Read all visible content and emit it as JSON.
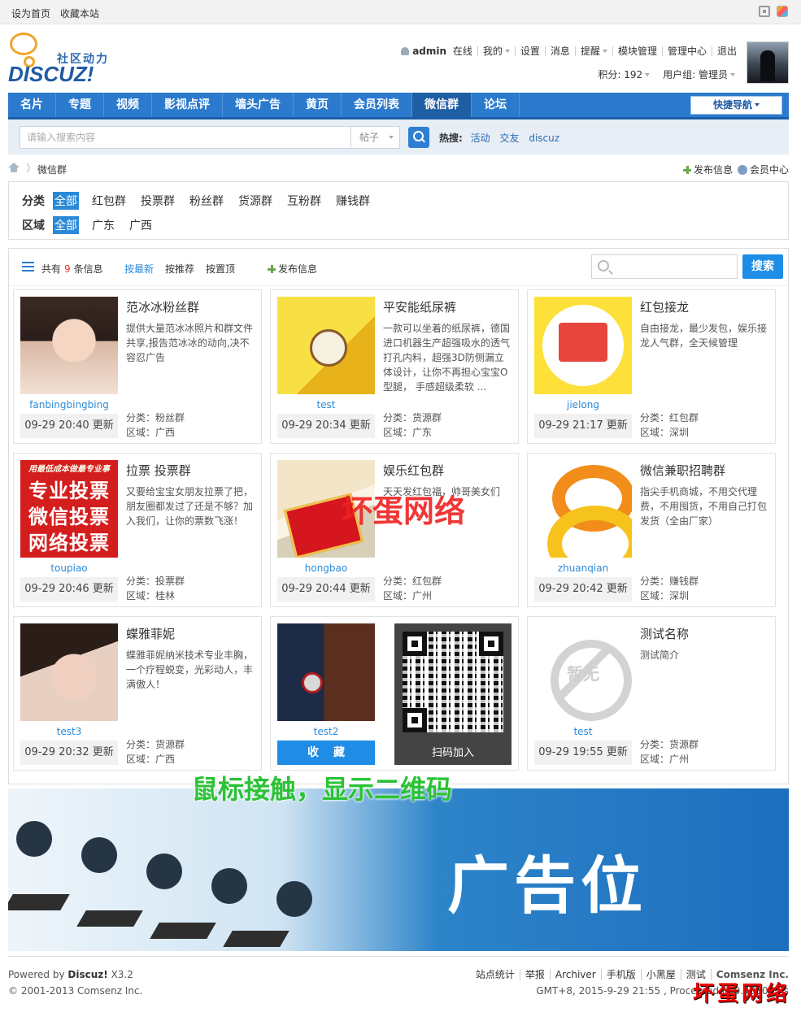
{
  "topbar": {
    "set_home": "设为首页",
    "bookmark": "收藏本站"
  },
  "logo": {
    "cn": "社区动力",
    "en": "DISCUZ!"
  },
  "user": {
    "name": "admin",
    "status": "在线",
    "menu": [
      "我的",
      "设置",
      "消息",
      "提醒",
      "模块管理",
      "管理中心",
      "退出"
    ],
    "points_label": "积分: 192",
    "group_label": "用户组: 管理员"
  },
  "nav": {
    "items": [
      "名片",
      "专题",
      "视频",
      "影视点评",
      "墙头广告",
      "黄页",
      "会员列表",
      "微信群",
      "论坛"
    ],
    "active": "微信群",
    "quick_nav": "快捷导航"
  },
  "search": {
    "placeholder": "请输入搜索内容",
    "type": "帖子",
    "hot_label": "热搜:",
    "hot_words": [
      "活动",
      "交友",
      "discuz"
    ]
  },
  "breadcrumb": {
    "current": "微信群",
    "sep": "〉",
    "publish": "发布信息",
    "member_center": "会员中心"
  },
  "filter": {
    "category_label": "分类",
    "categories": [
      "全部",
      "红包群",
      "投票群",
      "粉丝群",
      "货源群",
      "互粉群",
      "赚钱群"
    ],
    "region_label": "区域",
    "regions": [
      "全部",
      "广东",
      "广西"
    ]
  },
  "toolbar": {
    "total_prefix": "共有",
    "total_count": "9",
    "total_suffix": "条信息",
    "sorts": [
      "按最新",
      "按推荐",
      "按置顶"
    ],
    "publish": "发布信息",
    "search_button": "搜索"
  },
  "cards": [
    {
      "title": "范冰冰粉丝群",
      "desc": "提供大量范冰冰照片和群文件共享,报告范冰冰的动向,决不容忍广告",
      "user": "fanbingbingbing",
      "updated": "09-29 20:40 更新",
      "category": "分类：粉丝群",
      "region": "区域：广西"
    },
    {
      "title": "平安能纸尿裤",
      "desc": "一款可以坐着的纸尿裤，德国进口机器生产超强吸水的透气打孔内料，超强3D防侧漏立体设计，让你不再担心宝宝O型腿， 手感超级柔软 ...",
      "user": "test",
      "updated": "09-29 20:34 更新",
      "category": "分类：货源群",
      "region": "区域：广东"
    },
    {
      "title": "红包接龙",
      "desc": "自由接龙，最少发包，娱乐接龙人气群，全天候管理",
      "user": "jielong",
      "updated": "09-29 21:17 更新",
      "category": "分类：红包群",
      "region": "区域：深圳"
    },
    {
      "title": "拉票 投票群",
      "desc": "又要给宝宝女朋友拉票了把，朋友圈都发过了还是不够？加入我们，让你的票数飞涨！",
      "user": "toupiao",
      "updated": "09-29 20:46 更新",
      "category": "分类：投票群",
      "region": "区域：桂林"
    },
    {
      "title": "娱乐红包群",
      "desc": "天天发红包福，帅哥美女们",
      "user": "hongbao",
      "updated": "09-29 20:44 更新",
      "category": "分类：红包群",
      "region": "区域：广州"
    },
    {
      "title": "微信兼职招聘群",
      "desc": "指尖手机商城，不用交代理费，不用囤货，不用自己打包发货（全由厂家）",
      "user": "zhuanqian",
      "updated": "09-29 20:42 更新",
      "category": "分类：赚钱群",
      "region": "区域：深圳"
    },
    {
      "title": "蝶雅菲妮",
      "desc": "蝶雅菲妮纳米技术专业丰胸，一个疗程蜕变，光彩动人，丰满傲人！",
      "user": "test3",
      "updated": "09-29 20:32 更新",
      "category": "分类：货源群",
      "region": "区域：广西"
    },
    {
      "title": "",
      "desc": "",
      "user": "test2",
      "updated": "",
      "category": "",
      "region": "",
      "favorite": "收藏",
      "qr_label": "扫码加入"
    },
    {
      "title": "测试名称",
      "desc": "测试简介",
      "user": "test",
      "updated": "09-29 19:55 更新",
      "category": "分类：货源群",
      "region": "区域：广州"
    }
  ],
  "thumb_text": {
    "vote_small": "用最低成本做最专业事",
    "vote_lines": [
      "专业投票",
      "微信投票",
      "网络投票"
    ],
    "none": "暂无"
  },
  "watermark": "坏蛋网络",
  "hover_note": "鼠标接触，显示二维码",
  "ad_text": "广告位",
  "footer": {
    "powered_prefix": "Powered by",
    "powered_brand": "Discuz!",
    "powered_version": "X3.2",
    "copyright": "© 2001-2013 Comsenz Inc.",
    "links": [
      "站点统计",
      "举报",
      "Archiver",
      "手机版",
      "小黑屋",
      "测试"
    ],
    "company": "Comsenz Inc.",
    "gmt": "GMT+8, 2015-9-29 21:55 , Processed in 0.408003 s"
  },
  "watermark_footer": "坏蛋网络"
}
